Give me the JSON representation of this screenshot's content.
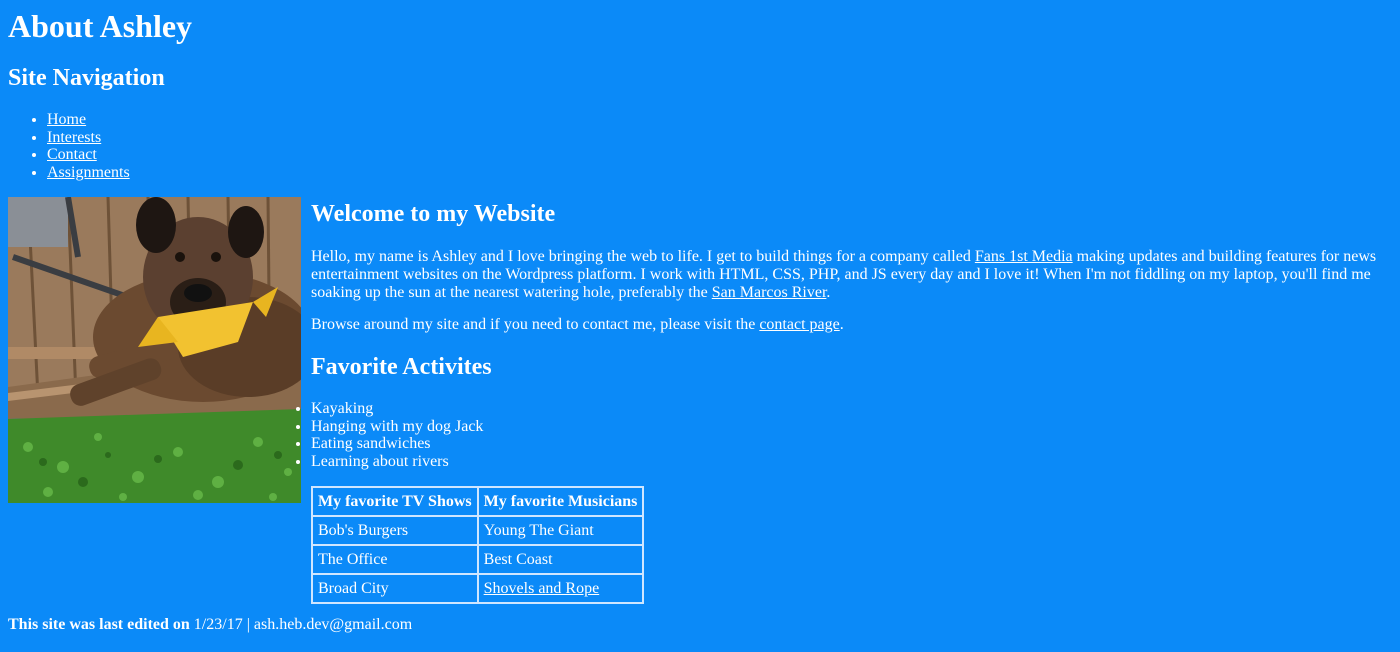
{
  "header": {
    "title": "About Ashley"
  },
  "nav": {
    "heading": "Site Navigation",
    "items": [
      {
        "label": "Home"
      },
      {
        "label": "Interests"
      },
      {
        "label": "Contact"
      },
      {
        "label": "Assignments"
      }
    ]
  },
  "welcome": {
    "heading": "Welcome to my Website",
    "p1_before": "Hello, my name is Ashley and I love bringing the web to life. I get to build things for a company called ",
    "p1_link1": "Fans 1st Media",
    "p1_middle": " making updates and building features for news entertainment websites on the Wordpress platform. I work with HTML, CSS, PHP, and JS every day and I love it! When I'm not fiddling on my laptop, you'll find me soaking up the sun at the nearest watering hole, preferably the ",
    "p1_link2": "San Marcos River",
    "p1_end": ".",
    "p2_before": "Browse around my site and if you need to contact me, please visit the ",
    "p2_link": "contact page",
    "p2_end": "."
  },
  "activities": {
    "heading": "Favorite Activites",
    "items": [
      "Kayaking",
      "Hanging with my dog Jack",
      "Eating sandwiches",
      "Learning about rivers"
    ]
  },
  "favorites_table": {
    "headers": [
      "My favorite TV Shows",
      "My favorite Musicians"
    ],
    "rows": [
      [
        "Bob's Burgers",
        "Young The Giant"
      ],
      [
        "The Office",
        "Best Coast"
      ],
      [
        "Broad City",
        "Shovels and Rope"
      ]
    ]
  },
  "footer": {
    "label": "This site was last edited on",
    "date": "1/23/17",
    "separator": "|",
    "email": "ash.heb.dev@gmail.com"
  },
  "colors": {
    "background": "#0b8af8",
    "text": "#ffffff"
  },
  "image": {
    "subject": "dog-photo"
  }
}
